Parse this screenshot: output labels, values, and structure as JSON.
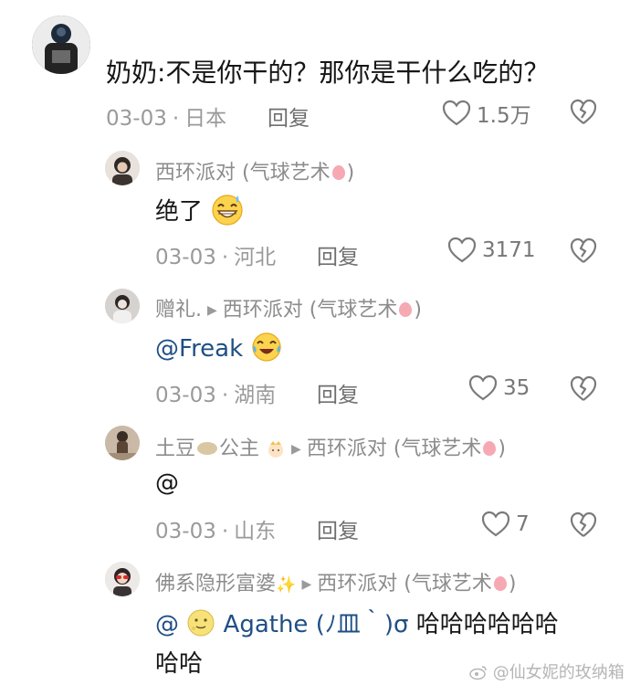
{
  "comments": [
    {
      "text": "奶奶:不是你干的？那你是干什么吃的？",
      "date": "03-03",
      "location": "日本",
      "reply_label": "回复",
      "likes": "1.5万"
    },
    {
      "user": "西环派对",
      "user_suffix": "(气球艺术",
      "user_close": ")",
      "text": "绝了",
      "date": "03-03",
      "location": "河北",
      "reply_label": "回复",
      "likes": "3171"
    },
    {
      "user": "赠礼.",
      "reply_to": "西环派对",
      "reply_to_suffix": "(气球艺术",
      "reply_to_close": ")",
      "mention": "@Freak",
      "date": "03-03",
      "location": "湖南",
      "reply_label": "回复",
      "likes": "35"
    },
    {
      "user": "土豆",
      "user_suffix": "公主",
      "reply_to": "西环派对",
      "reply_to_suffix": "(气球艺术",
      "reply_to_close": ")",
      "text": "@",
      "date": "03-03",
      "location": "山东",
      "reply_label": "回复",
      "likes": "7"
    },
    {
      "user": "佛系隐形富婆",
      "reply_to": "西环派对",
      "reply_to_suffix": "(气球艺术",
      "reply_to_close": ")",
      "mention_prefix": "@",
      "mention_name": "Agathe (ﾉ皿｀)σ",
      "text_suffix": "哈哈哈哈哈哈",
      "text_line2": "哈哈"
    }
  ],
  "watermark": "@仙女妮的玫纳箱",
  "colors": {
    "mention": "#1f4f84",
    "meta": "#9a9a9a",
    "name": "#8c8c8c"
  }
}
